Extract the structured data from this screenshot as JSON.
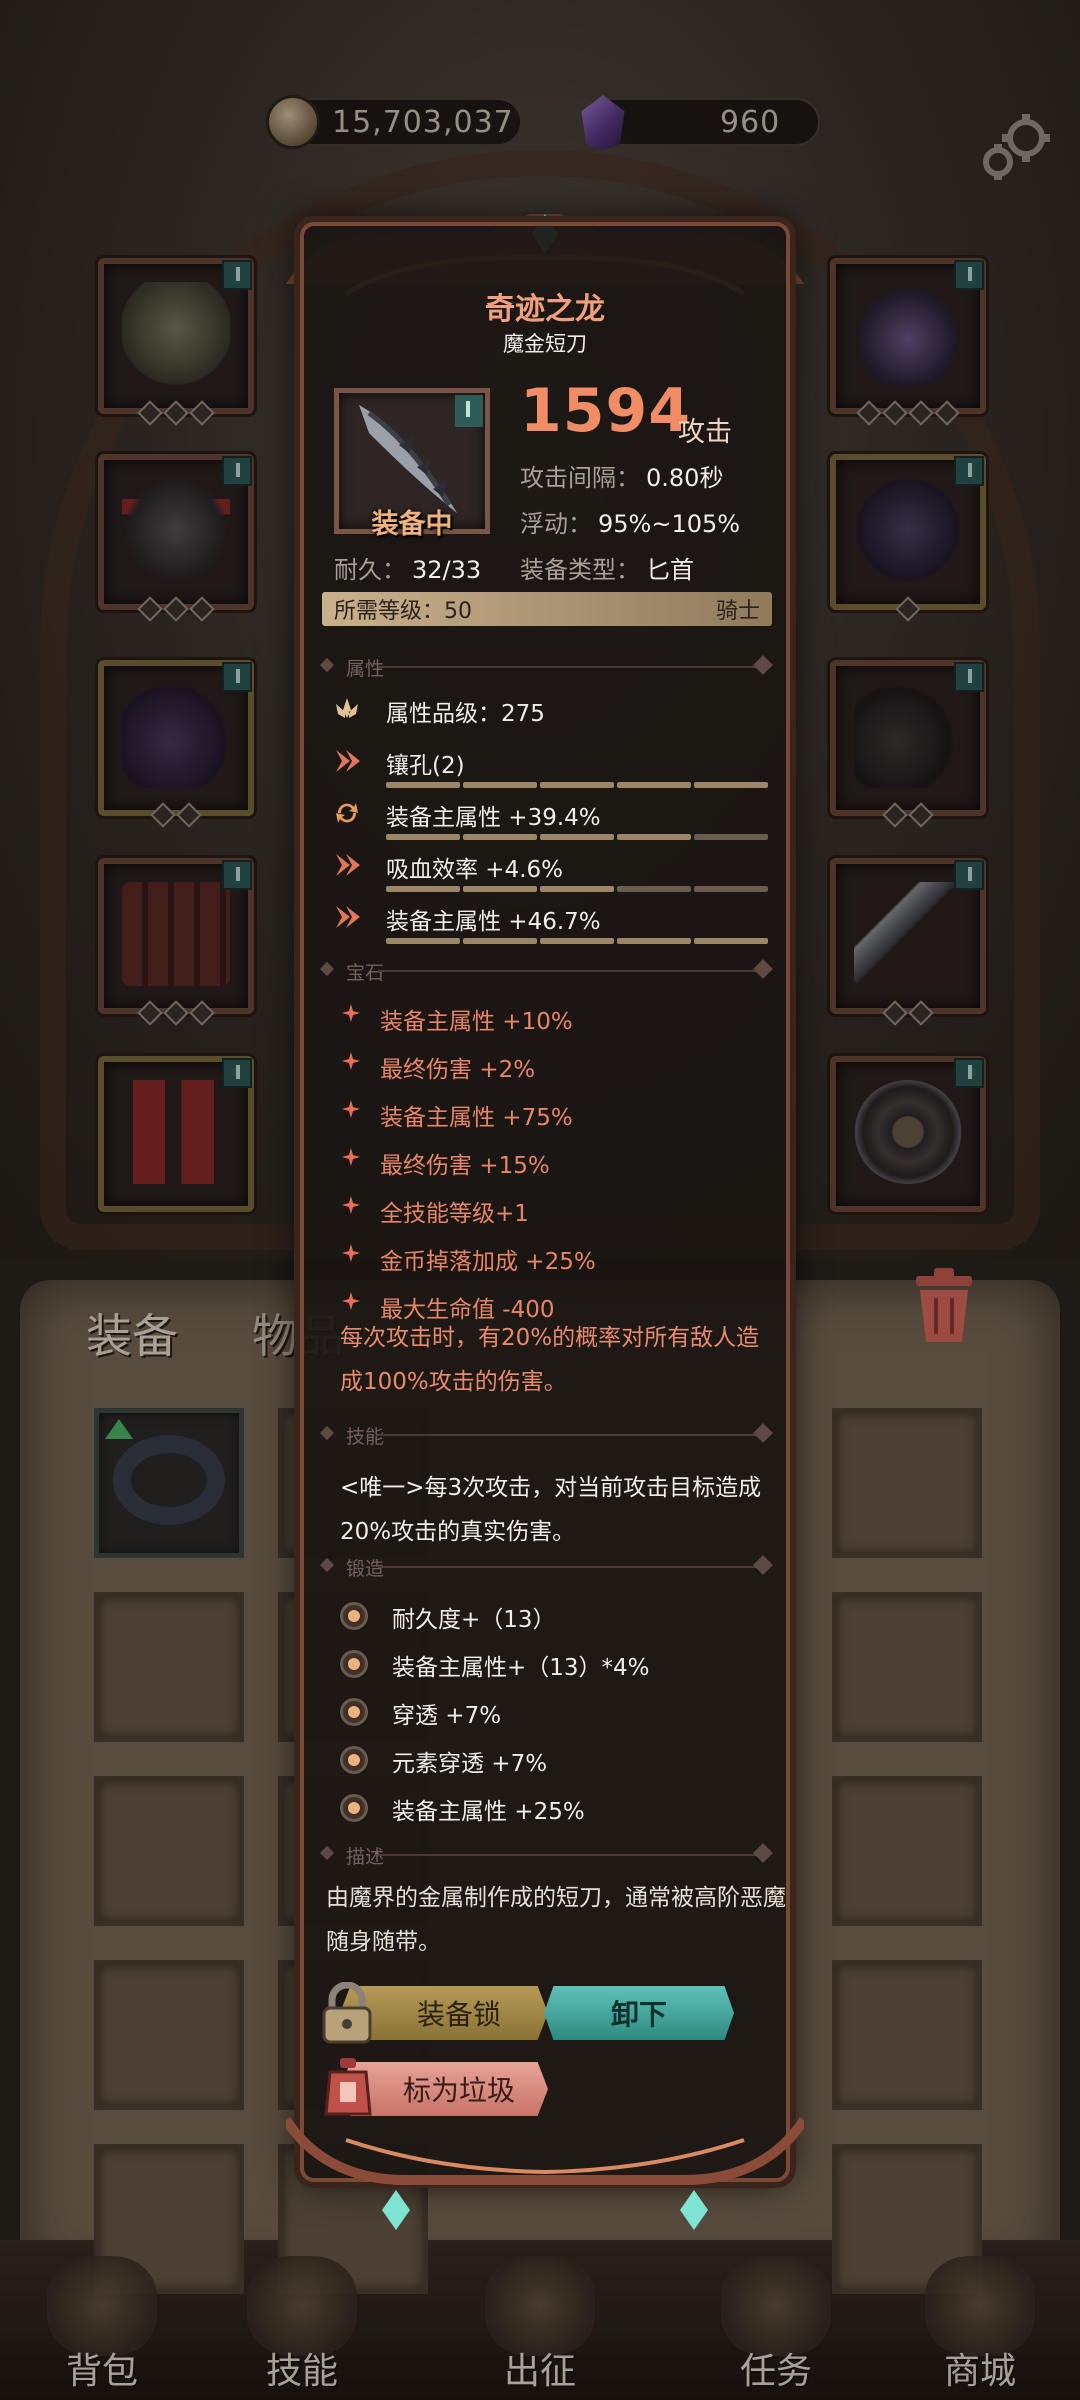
{
  "currency": {
    "gold": "15,703,037",
    "gems": "960"
  },
  "bag": {
    "tab_equipment": "装备",
    "tab_items": "物品"
  },
  "nav": {
    "backpack": "背包",
    "skills": "技能",
    "expedition": "出征",
    "quests": "任务",
    "shop": "商城"
  },
  "item": {
    "name": "奇迹之龙",
    "type_name": "魔金短刀",
    "equipped_label": "装备中",
    "attack_value": "1594",
    "attack_label": "攻击",
    "attack_interval_label": "攻击间隔：",
    "attack_interval_value": "0.80秒",
    "float_label": "浮动：",
    "float_value": "95%~105%",
    "durability_label": "耐久：",
    "durability_value": "32/33",
    "equip_type_label": "装备类型：",
    "equip_type_value": "匕首",
    "required_level_label": "所需等级：",
    "required_level_value": "50",
    "class": "骑士"
  },
  "sections": {
    "attributes": "属性",
    "gems": "宝石",
    "skill": "技能",
    "forge": "锻造",
    "description": "描述"
  },
  "attributes": [
    {
      "text": "属性品级：275",
      "icon": "lotus-icon"
    },
    {
      "text": "镶孔(2)",
      "icon": "arrow-chevron-icon"
    },
    {
      "text": "装备主属性 +39.4%",
      "icon": "refresh-icon"
    },
    {
      "text": "吸血效率 +4.6%",
      "icon": "arrow-chevron-icon"
    },
    {
      "text": "装备主属性 +46.7%",
      "icon": "arrow-chevron-icon"
    }
  ],
  "gems": [
    "装备主属性 +10%",
    "最终伤害 +2%",
    "装备主属性 +75%",
    "最终伤害 +15%",
    "全技能等级+1",
    "金币掉落加成 +25%",
    "最大生命值 -400"
  ],
  "effect_text": "每次攻击时，有20%的概率对所有敌人造成100%攻击的伤害。",
  "skill_text": "<唯一>每3次攻击，对当前攻击目标造成20%攻击的真实伤害。",
  "forge": [
    "耐久度+（13）",
    "装备主属性+（13）*4%",
    "穿透 +7%",
    "元素穿透 +7%",
    "装备主属性 +25%"
  ],
  "description": "由魔界的金属制作成的短刀，通常被高阶恶魔随身随带。",
  "buttons": {
    "lock": "装备锁",
    "unequip": "卸下",
    "mark_junk": "标为垃圾"
  },
  "colors": {
    "title": "#f0a07e",
    "attack": "#f08d67",
    "gem_text": "#e88566",
    "unequip_button": "#4fb0a6",
    "lock_button": "#a68a48",
    "junk_button": "#d88a7e"
  }
}
